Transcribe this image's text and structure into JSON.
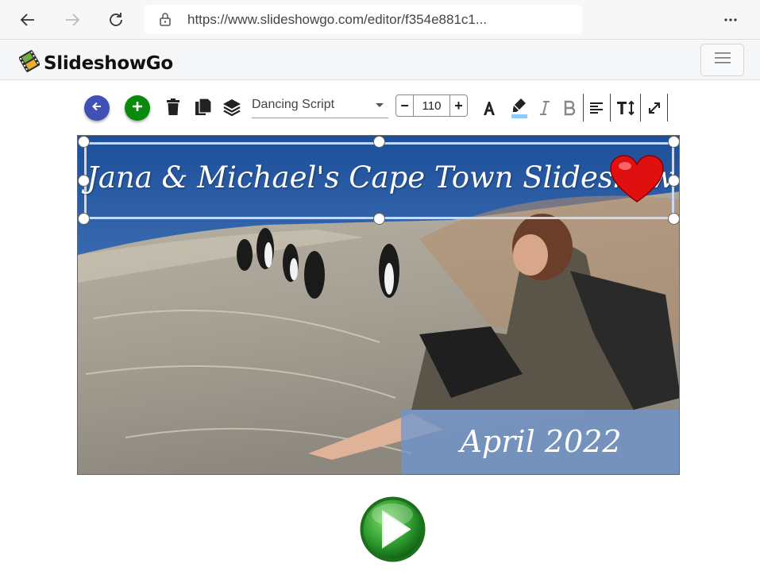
{
  "browser": {
    "url": "https://www.slideshowgo.com/editor/f354e881c1...",
    "icons": [
      "back-arrow-icon",
      "forward-arrow-icon",
      "reload-icon",
      "lock-icon",
      "more-icon"
    ]
  },
  "app": {
    "brand": "SlideshowGo",
    "menu_icon": "hamburger-icon"
  },
  "toolbar": {
    "font_name": "Dancing Script",
    "font_size": "110",
    "minus": "−",
    "plus": "+",
    "colors": {
      "back": "#3f51b5",
      "add": "#0a8a0a",
      "highlight": "#90caf9"
    },
    "icons": [
      "back-icon",
      "add-icon",
      "delete-icon",
      "copy-icon",
      "layers-icon",
      "text-color-icon",
      "highlight-icon",
      "italic-icon",
      "bold-icon",
      "align-left-icon",
      "text-size-icon",
      "expand-icon"
    ]
  },
  "slide": {
    "title": "Jana & Michael's Cape Town Slideshow",
    "date": "April 2022"
  },
  "player": {
    "icon": "play-icon",
    "color": "#2e9b2e"
  }
}
